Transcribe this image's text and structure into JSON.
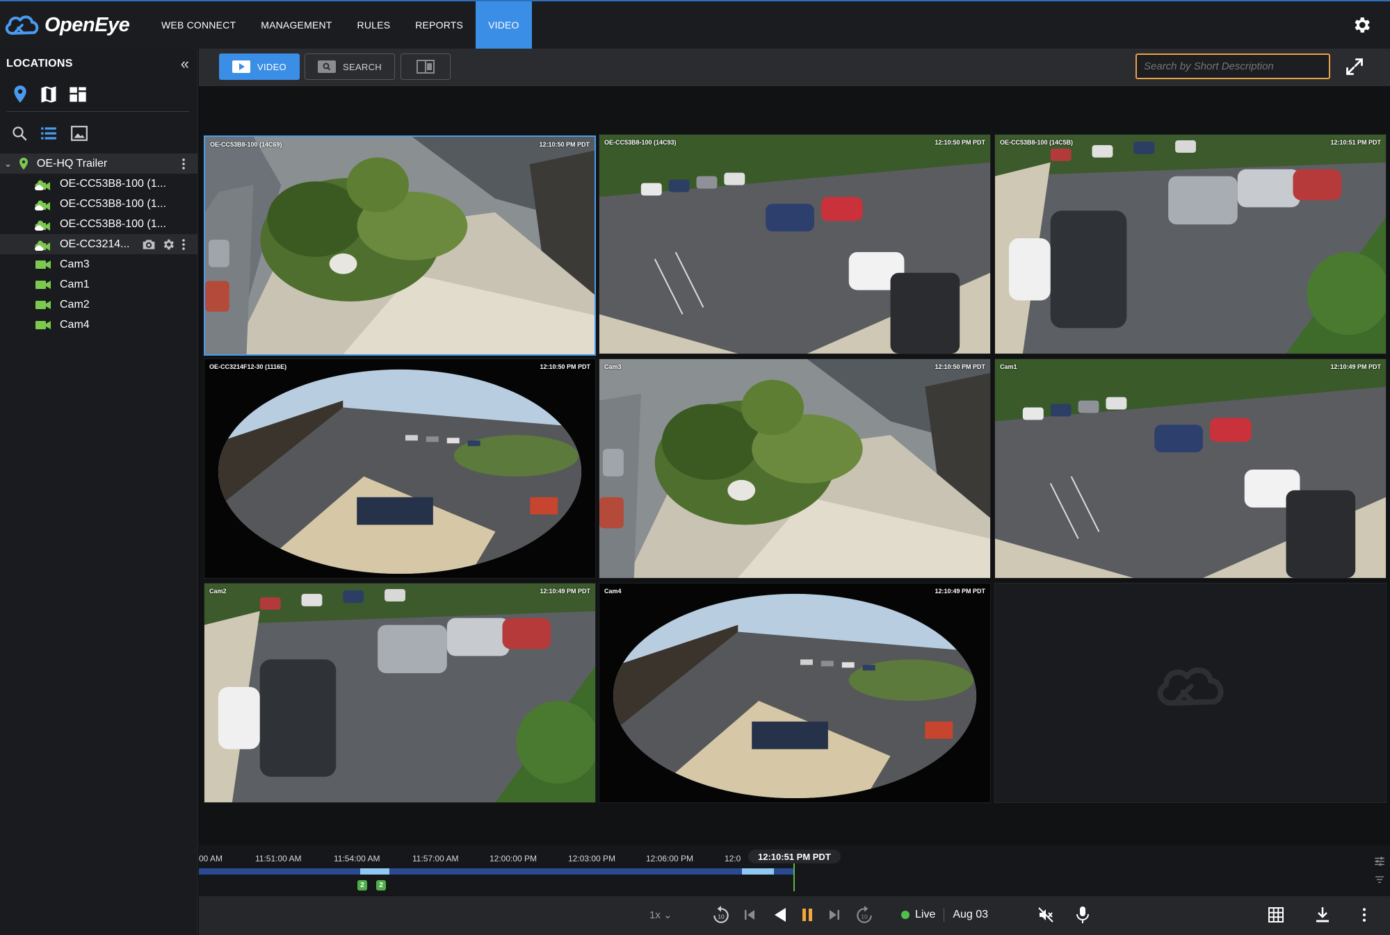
{
  "brand": {
    "name": "OpenEye"
  },
  "nav": [
    {
      "label": "WEB CONNECT",
      "active": false
    },
    {
      "label": "MANAGEMENT",
      "active": false
    },
    {
      "label": "RULES",
      "active": false
    },
    {
      "label": "REPORTS",
      "active": false
    },
    {
      "label": "VIDEO",
      "active": true
    }
  ],
  "colors": {
    "accent": "#3b8ee6",
    "search_border": "#e8a24a",
    "live": "#4fbf4a",
    "camera_icon": "#7cc94f"
  },
  "sidebar": {
    "title": "LOCATIONS",
    "tree": {
      "root": "OE-HQ Trailer",
      "items": [
        {
          "label": "OE-CC53B8-100 (1...",
          "icon": "cloud-camera-icon"
        },
        {
          "label": "OE-CC53B8-100 (1...",
          "icon": "cloud-camera-icon"
        },
        {
          "label": "OE-CC53B8-100 (1...",
          "icon": "cloud-camera-icon"
        },
        {
          "label": "OE-CC3214...",
          "icon": "cloud-camera-icon"
        },
        {
          "label": "Cam3",
          "icon": "camera-icon"
        },
        {
          "label": "Cam1",
          "icon": "camera-icon"
        },
        {
          "label": "Cam2",
          "icon": "camera-icon"
        },
        {
          "label": "Cam4",
          "icon": "camera-icon"
        }
      ]
    }
  },
  "toolbar": {
    "video_label": "VIDEO",
    "search_label": "SEARCH",
    "search_placeholder": "Search by Short Description"
  },
  "tiles": [
    {
      "name": "OE-CC53B8-100 (14C69)",
      "time": "12:10:50 PM PDT",
      "scene": "courtyard",
      "selected": true
    },
    {
      "name": "OE-CC53B8-100 (14C93)",
      "time": "12:10:50 PM PDT",
      "scene": "parking"
    },
    {
      "name": "OE-CC53B8-100 (14C5B)",
      "time": "12:10:51 PM PDT",
      "scene": "trucks"
    },
    {
      "name": "OE-CC3214F12-30 (1116E)",
      "time": "12:10:50 PM PDT",
      "scene": "fisheye"
    },
    {
      "name": "Cam3",
      "time": "12:10:50 PM PDT",
      "scene": "courtyard"
    },
    {
      "name": "Cam1",
      "time": "12:10:49 PM PDT",
      "scene": "parking"
    },
    {
      "name": "Cam2",
      "time": "12:10:49 PM PDT",
      "scene": "trucks"
    },
    {
      "name": "Cam4",
      "time": "12:10:49 PM PDT",
      "scene": "fisheye"
    }
  ],
  "timeline": {
    "ticks": [
      "00 AM",
      "11:51:00 AM",
      "11:54:00 AM",
      "11:57:00 AM",
      "12:00:00 PM",
      "12:03:00 PM",
      "12:06:00 PM",
      "12:0"
    ],
    "current_time": "12:10:51 PM PDT",
    "event_markers": [
      "2",
      "2"
    ]
  },
  "controls": {
    "speed": "1x",
    "rewind_seconds": "10",
    "forward_seconds": "10",
    "live_label": "Live",
    "date": "Aug 03"
  }
}
